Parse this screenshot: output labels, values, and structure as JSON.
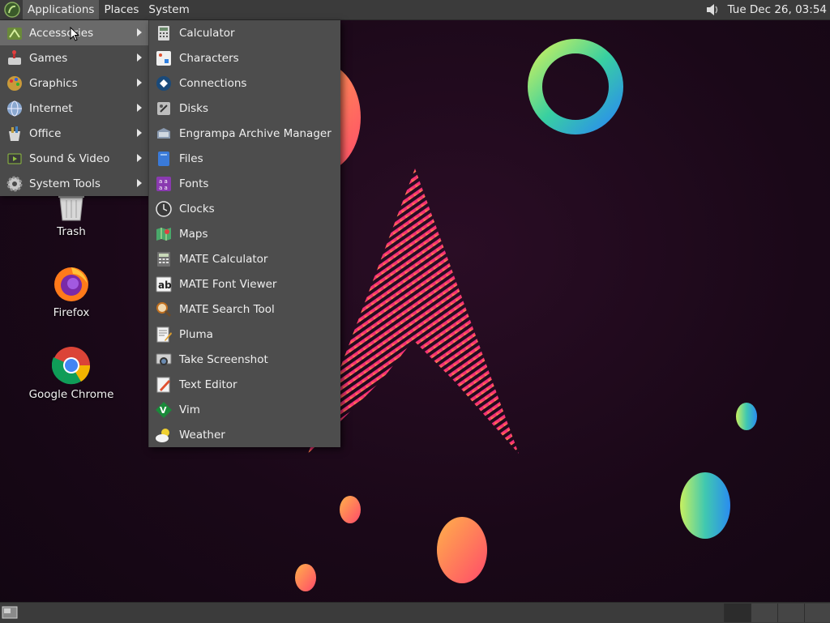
{
  "top_panel": {
    "menus": [
      "Applications",
      "Places",
      "System"
    ],
    "clock": "Tue Dec 26, 03:54"
  },
  "desktop": {
    "icons": [
      {
        "label": "Trash",
        "icon": "trash-icon"
      },
      {
        "label": "Firefox",
        "icon": "firefox-icon"
      },
      {
        "label": "Google Chrome",
        "icon": "chrome-icon"
      }
    ]
  },
  "applications_menu": {
    "categories": [
      {
        "label": "Accessories",
        "icon": "accessories-icon",
        "selected": true
      },
      {
        "label": "Games",
        "icon": "games-icon"
      },
      {
        "label": "Graphics",
        "icon": "graphics-icon"
      },
      {
        "label": "Internet",
        "icon": "internet-icon"
      },
      {
        "label": "Office",
        "icon": "office-icon"
      },
      {
        "label": "Sound & Video",
        "icon": "sound-video-icon"
      },
      {
        "label": "System Tools",
        "icon": "system-tools-icon"
      }
    ],
    "accessories": [
      {
        "label": "Calculator",
        "icon": "calculator-icon"
      },
      {
        "label": "Characters",
        "icon": "characters-icon"
      },
      {
        "label": "Connections",
        "icon": "connections-icon"
      },
      {
        "label": "Disks",
        "icon": "disks-icon"
      },
      {
        "label": "Engrampa Archive Manager",
        "icon": "archive-icon"
      },
      {
        "label": "Files",
        "icon": "files-icon"
      },
      {
        "label": "Fonts",
        "icon": "fonts-icon"
      },
      {
        "label": "Clocks",
        "icon": "clocks-icon"
      },
      {
        "label": "Maps",
        "icon": "maps-icon"
      },
      {
        "label": "MATE Calculator",
        "icon": "mate-calculator-icon"
      },
      {
        "label": "MATE Font Viewer",
        "icon": "font-viewer-icon"
      },
      {
        "label": "MATE Search Tool",
        "icon": "search-tool-icon"
      },
      {
        "label": "Pluma",
        "icon": "pluma-icon"
      },
      {
        "label": "Take Screenshot",
        "icon": "screenshot-icon"
      },
      {
        "label": "Text Editor",
        "icon": "text-editor-icon"
      },
      {
        "label": "Vim",
        "icon": "vim-icon"
      },
      {
        "label": "Weather",
        "icon": "weather-icon"
      }
    ]
  },
  "colors": {
    "panel": "#3b3b3b",
    "menu_bg": "#4a4a4a",
    "menu_selected": "#6a6a6a",
    "wallpaper": "#1a0818"
  }
}
